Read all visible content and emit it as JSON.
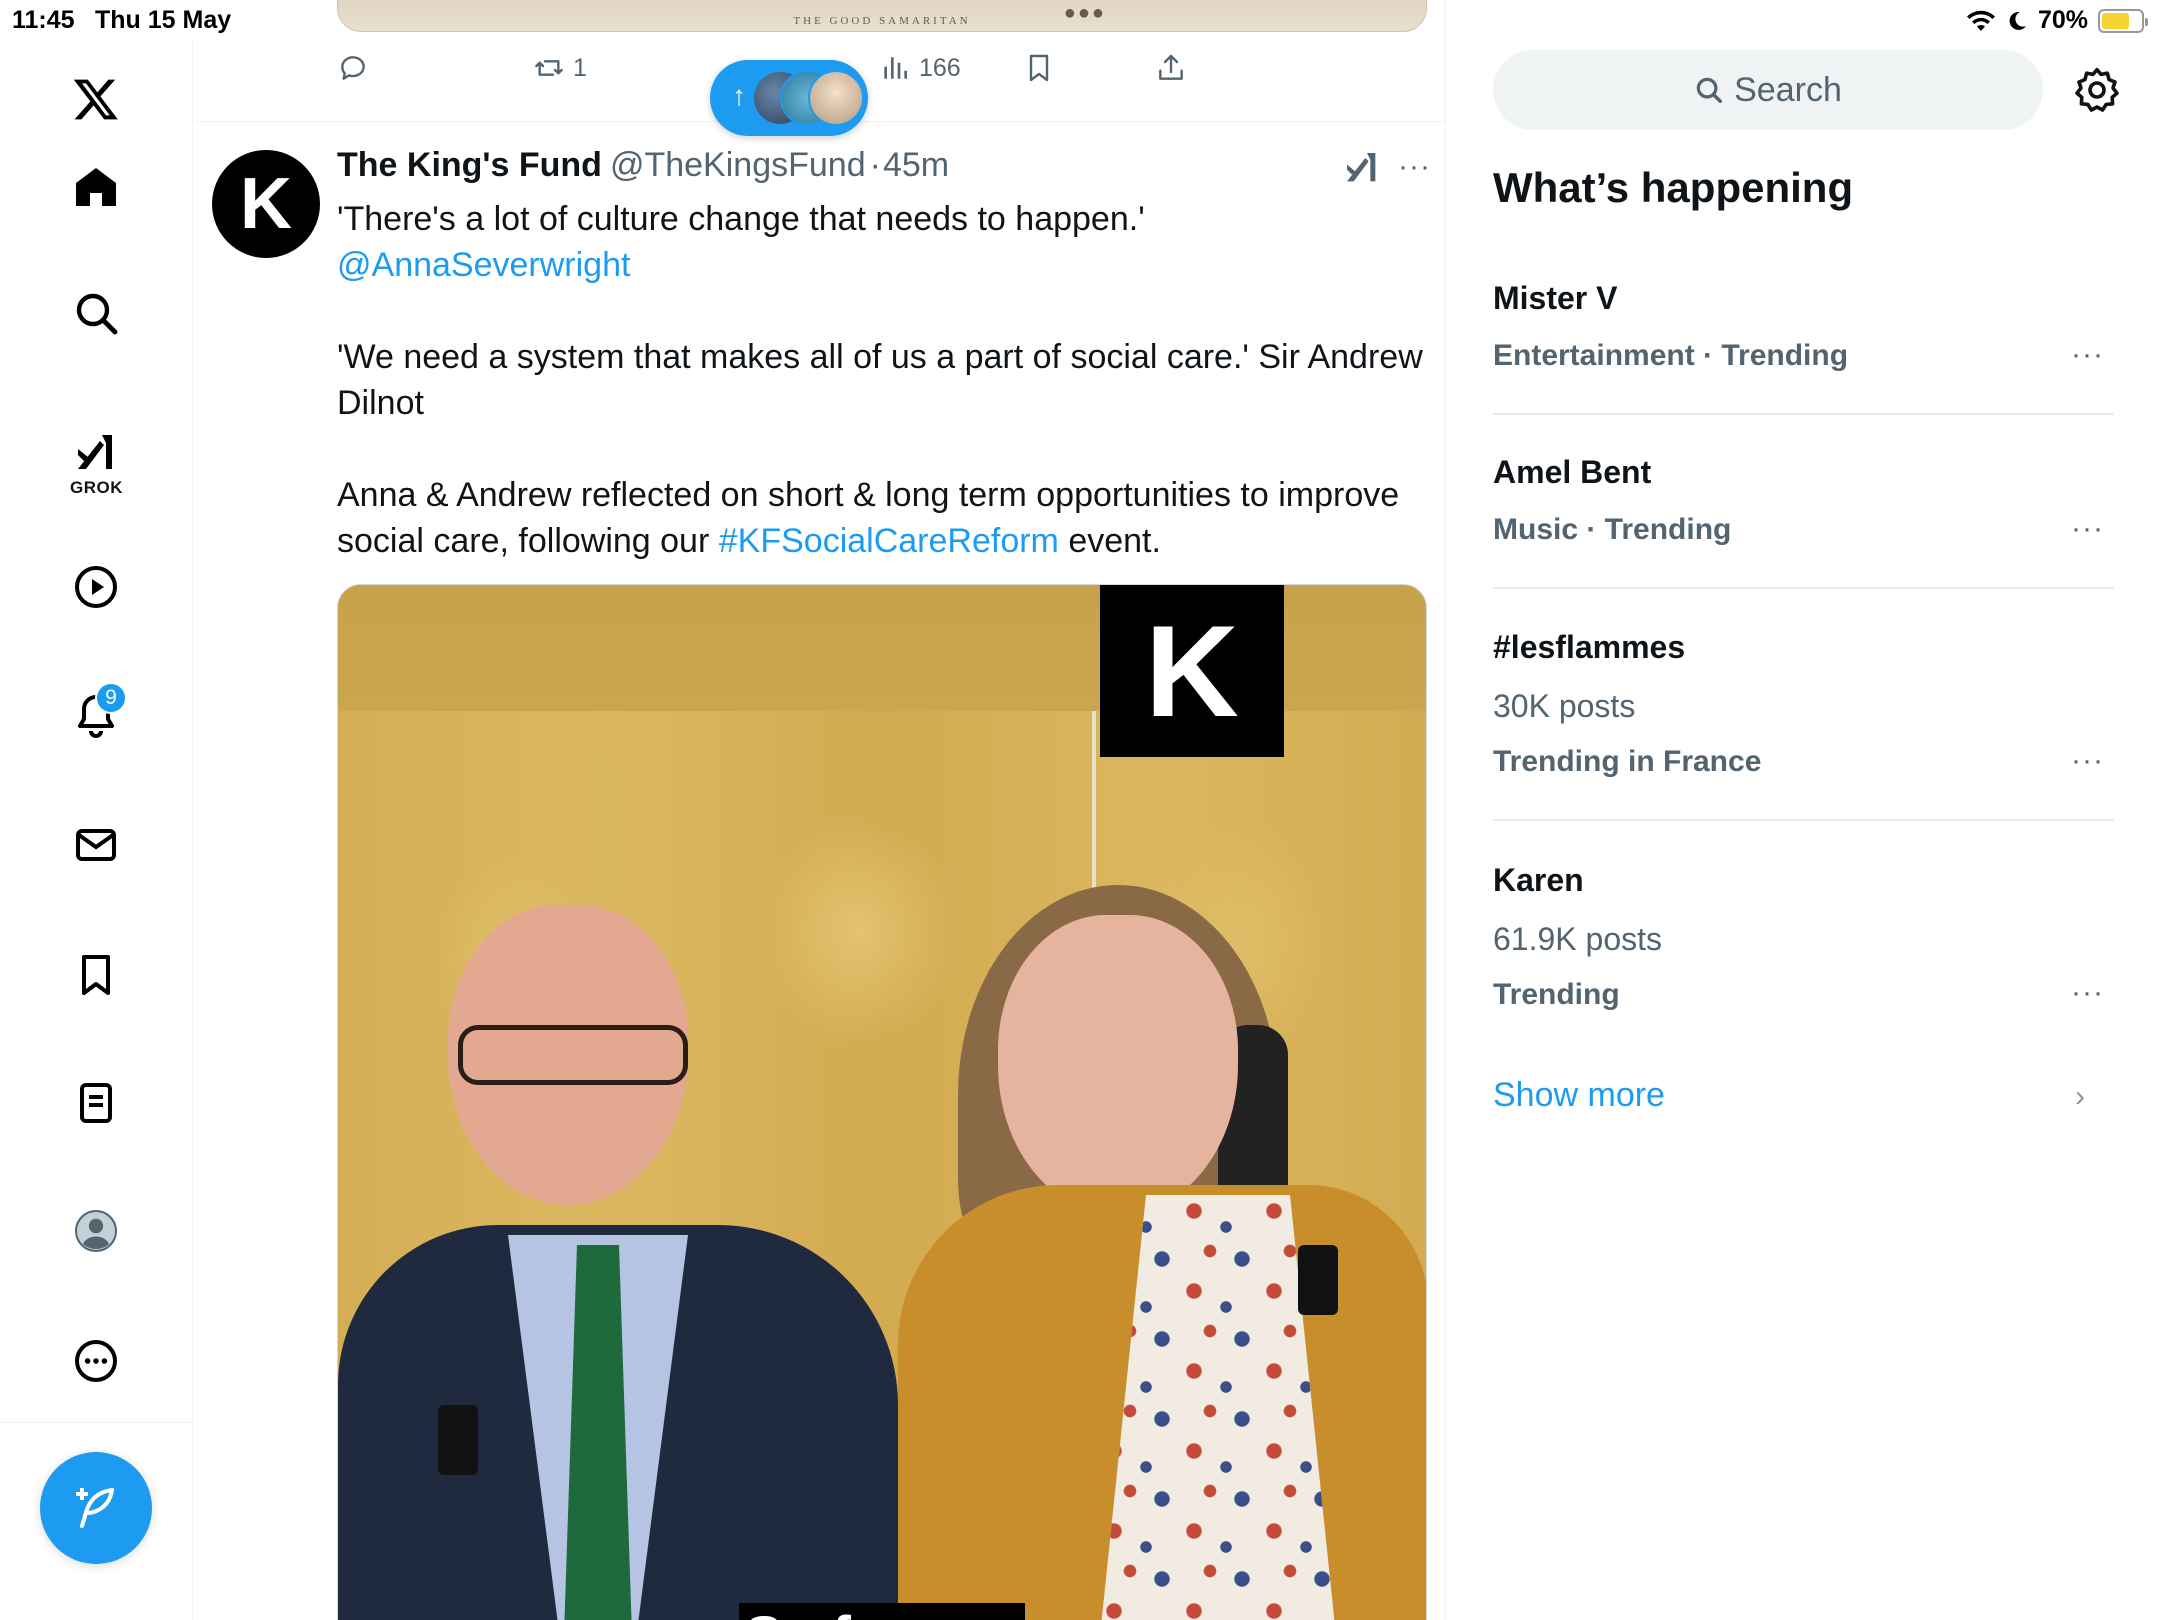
{
  "status_bar": {
    "time": "11:45",
    "date": "Thu 15 May",
    "battery": "70%",
    "battery_level": 0.7
  },
  "nav": {
    "grok_label": "GROK",
    "notifications_badge": "9"
  },
  "previous_post": {
    "media_caption": "THE GOOD SAMARITAN",
    "retweets": "1",
    "views": "166"
  },
  "new_posts_pill": {
    "arrow": "↑"
  },
  "tweet": {
    "avatar_letter": "K",
    "name": "The King's Fund",
    "handle": "@TheKingsFund",
    "separator": "·",
    "time": "45m",
    "line1": "'There's a lot of culture change that needs to happen.'",
    "mention": "@AnnaSeverwright",
    "line2": "'We need a system that makes all of us a part of social care.' Sir Andrew Dilnot",
    "line3_before": "Anna & Andrew reflected on short & long term opportunities to improve social care, following our ",
    "hashtag": "#KFSocialCareReform",
    "line3_after": " event.",
    "video_logo": "K",
    "video_subtitle": "So for me,"
  },
  "right": {
    "search_placeholder": "Search",
    "section_title": "What’s happening",
    "trends": [
      {
        "title": "Mister V",
        "meta": "Entertainment · Trending",
        "count": ""
      },
      {
        "title": "Amel Bent",
        "meta": "Music · Trending",
        "count": ""
      },
      {
        "title": "#lesflammes",
        "count": "30K posts",
        "meta": "Trending in France"
      },
      {
        "title": "Karen",
        "count": "61.9K posts",
        "meta": "Trending"
      }
    ],
    "show_more": "Show more"
  },
  "colors": {
    "accent": "#1d9bf0",
    "text_primary": "#0f1419",
    "text_secondary": "#536471"
  }
}
